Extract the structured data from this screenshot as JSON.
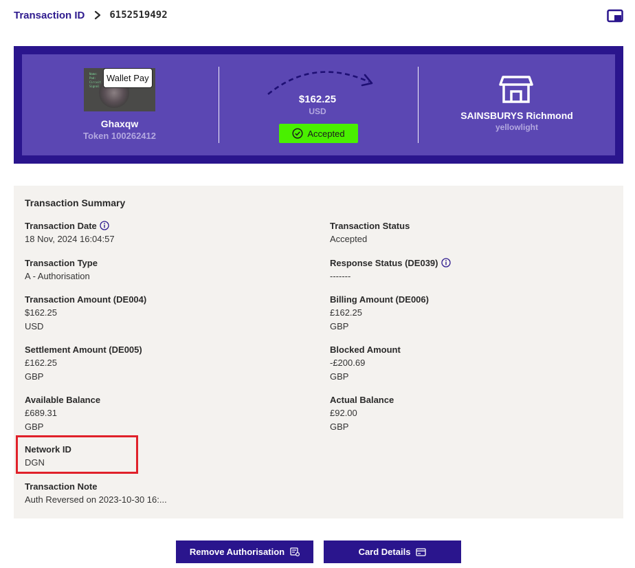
{
  "breadcrumb": {
    "parent": "Transaction ID",
    "current": "6152519492"
  },
  "hero": {
    "wallet_badge": "Wallet Pay",
    "holder_name": "Ghaxqw",
    "token": "Token 100262412",
    "amount": "$162.25",
    "currency": "USD",
    "status": "Accepted",
    "merchant": "SAINSBURYS Richmond",
    "merchant_sub": "yellowlight"
  },
  "summary": {
    "title": "Transaction Summary",
    "fields": [
      {
        "label": "Transaction Date",
        "value": "18 Nov, 2024 16:04:57"
      },
      {
        "label": "Transaction Status",
        "value": "Accepted"
      },
      {
        "label": "Transaction Type",
        "value": "A - Authorisation"
      },
      {
        "label": "Response Status (DE039)",
        "value": "-------"
      },
      {
        "label": "Transaction Amount (DE004)",
        "value": "$162.25",
        "value2": "USD"
      },
      {
        "label": "Billing Amount (DE006)",
        "value": "£162.25",
        "value2": "GBP"
      },
      {
        "label": "Settlement Amount (DE005)",
        "value": "£162.25",
        "value2": "GBP"
      },
      {
        "label": "Blocked Amount",
        "value": "-£200.69",
        "value2": "GBP"
      },
      {
        "label": "Available Balance",
        "value": "£689.31",
        "value2": "GBP"
      },
      {
        "label": "Actual Balance",
        "value": "£92.00",
        "value2": "GBP"
      },
      {
        "label": "Network ID",
        "value": "DGN"
      },
      {
        "label": "Transaction Note",
        "value": "Auth Reversed on 2023-10-30 16:..."
      }
    ]
  },
  "actions": {
    "remove_auth": "Remove Authorisation",
    "card_details": "Card Details"
  },
  "colors": {
    "brand": "#2a158d",
    "hero_bg": "#5b47b3",
    "accepted": "#49f000",
    "highlight": "#e0212a"
  },
  "icons": [
    "chevron-right-icon",
    "panel-icon",
    "check-circle-icon",
    "store-icon",
    "info-icon",
    "receipt-icon",
    "card-icon"
  ]
}
